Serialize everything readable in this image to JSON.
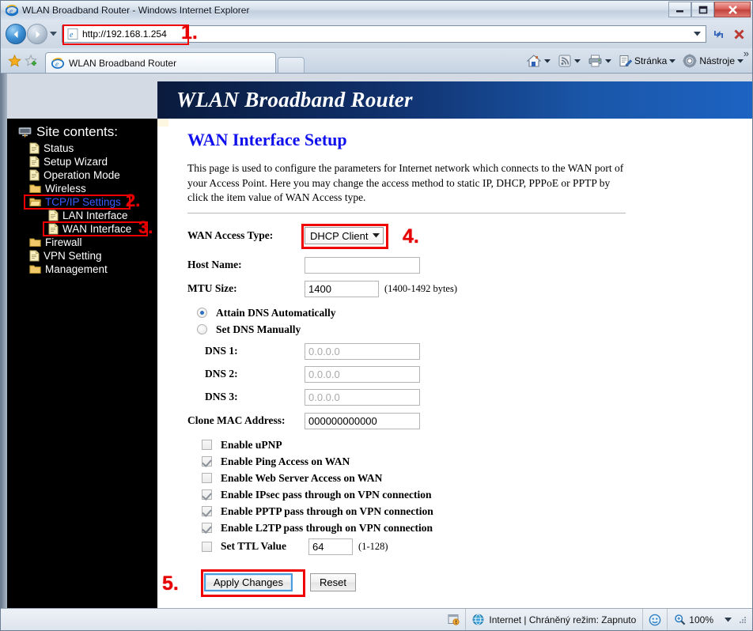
{
  "window": {
    "title": "WLAN Broadband Router - Windows Internet Explorer",
    "minimize_label": "Minimize",
    "maximize_label": "Maximize",
    "close_label": "Close"
  },
  "navbar": {
    "back_label": "Back",
    "forward_label": "Forward",
    "history_label": "Recent Pages",
    "url": "http://192.168.1.254",
    "dropdown_label": "Address dropdown",
    "refresh_label": "Refresh",
    "stop_label": "Stop",
    "annotation": "1."
  },
  "tabbar": {
    "favorites_label": "Favorites Center",
    "add_favorite_label": "Add to Favorites",
    "tab_title": "WLAN Broadband Router",
    "new_tab_label": "New Tab",
    "commands": [
      {
        "icon": "home-icon",
        "label": ""
      },
      {
        "icon": "feeds-icon",
        "label": ""
      },
      {
        "icon": "print-icon",
        "label": ""
      },
      {
        "icon": "page-icon",
        "label": "Stránka"
      },
      {
        "icon": "tools-icon",
        "label": "Nástroje"
      }
    ],
    "overflow_label": "»"
  },
  "sidebar": {
    "root_label": "Site contents:",
    "items": [
      {
        "label": "Status",
        "level": 1,
        "icon": "document-icon",
        "active": false,
        "boxed": false
      },
      {
        "label": "Setup Wizard",
        "level": 1,
        "icon": "document-icon",
        "active": false,
        "boxed": false
      },
      {
        "label": "Operation Mode",
        "level": 1,
        "icon": "document-icon",
        "active": false,
        "boxed": false
      },
      {
        "label": "Wireless",
        "level": 1,
        "icon": "folder-icon",
        "active": false,
        "boxed": false
      },
      {
        "label": "TCP/IP Settings",
        "level": 1,
        "icon": "folder-open-icon",
        "active": true,
        "boxed": true,
        "annotation": "2."
      },
      {
        "label": "LAN Interface",
        "level": 2,
        "icon": "document-icon",
        "active": false,
        "boxed": false
      },
      {
        "label": "WAN Interface",
        "level": 2,
        "icon": "document-icon",
        "active": false,
        "boxed": true,
        "annotation": "3."
      },
      {
        "label": "Firewall",
        "level": 1,
        "icon": "folder-icon",
        "active": false,
        "boxed": false
      },
      {
        "label": "VPN Setting",
        "level": 1,
        "icon": "document-icon",
        "active": false,
        "boxed": false
      },
      {
        "label": "Management",
        "level": 1,
        "icon": "folder-icon",
        "active": false,
        "boxed": false
      }
    ]
  },
  "page": {
    "banner_title": "WLAN Broadband Router",
    "title": "WAN Interface Setup",
    "description": "This page is used to configure the parameters for Internet network which connects to the WAN port of your Access Point. Here you may change the access method to static IP, DHCP, PPPoE or PPTP by click the item value of WAN Access type.",
    "fields": {
      "wan_access_type_label": "WAN Access Type:",
      "wan_access_type_value": "DHCP Client",
      "wan_access_type_annotation": "4.",
      "host_name_label": "Host Name:",
      "host_name_value": "",
      "mtu_size_label": "MTU Size:",
      "mtu_size_value": "1400",
      "mtu_size_hint": "(1400-1492 bytes)",
      "dns_auto_label": "Attain DNS Automatically",
      "dns_manual_label": "Set DNS Manually",
      "dns1_label": "DNS 1:",
      "dns1_value": "0.0.0.0",
      "dns2_label": "DNS 2:",
      "dns2_value": "0.0.0.0",
      "dns3_label": "DNS 3:",
      "dns3_value": "0.0.0.0",
      "clone_mac_label": "Clone MAC Address:",
      "clone_mac_value": "000000000000",
      "ttl_value": "64",
      "ttl_hint": "(1-128)"
    },
    "checkboxes": [
      {
        "label": "Enable uPNP",
        "checked": false
      },
      {
        "label": "Enable Ping Access on WAN",
        "checked": true
      },
      {
        "label": "Enable Web Server Access on WAN",
        "checked": false
      },
      {
        "label": "Enable IPsec pass through on VPN connection",
        "checked": true
      },
      {
        "label": "Enable PPTP pass through on VPN connection",
        "checked": true
      },
      {
        "label": "Enable L2TP pass through on VPN connection",
        "checked": true
      },
      {
        "label": "Set TTL Value",
        "checked": false
      }
    ],
    "buttons": {
      "apply_label": "Apply Changes",
      "reset_label": "Reset",
      "apply_annotation": "5."
    }
  },
  "statusbar": {
    "zone_text": "Internet | Chráněný režim: Zapnuto",
    "zoom_level": "100%",
    "zone_icon": "globe-icon",
    "security_icon": "shield-warning-icon",
    "privacy_icon": "privacy-report-icon",
    "zoom_icon": "magnifier-icon"
  },
  "colors": {
    "accent_blue": "#1d63c2",
    "banner_dark": "#0a1b3d",
    "annotation_red": "#ee0000",
    "link_blue": "#3a5cff",
    "title_blue": "#1010ee"
  }
}
